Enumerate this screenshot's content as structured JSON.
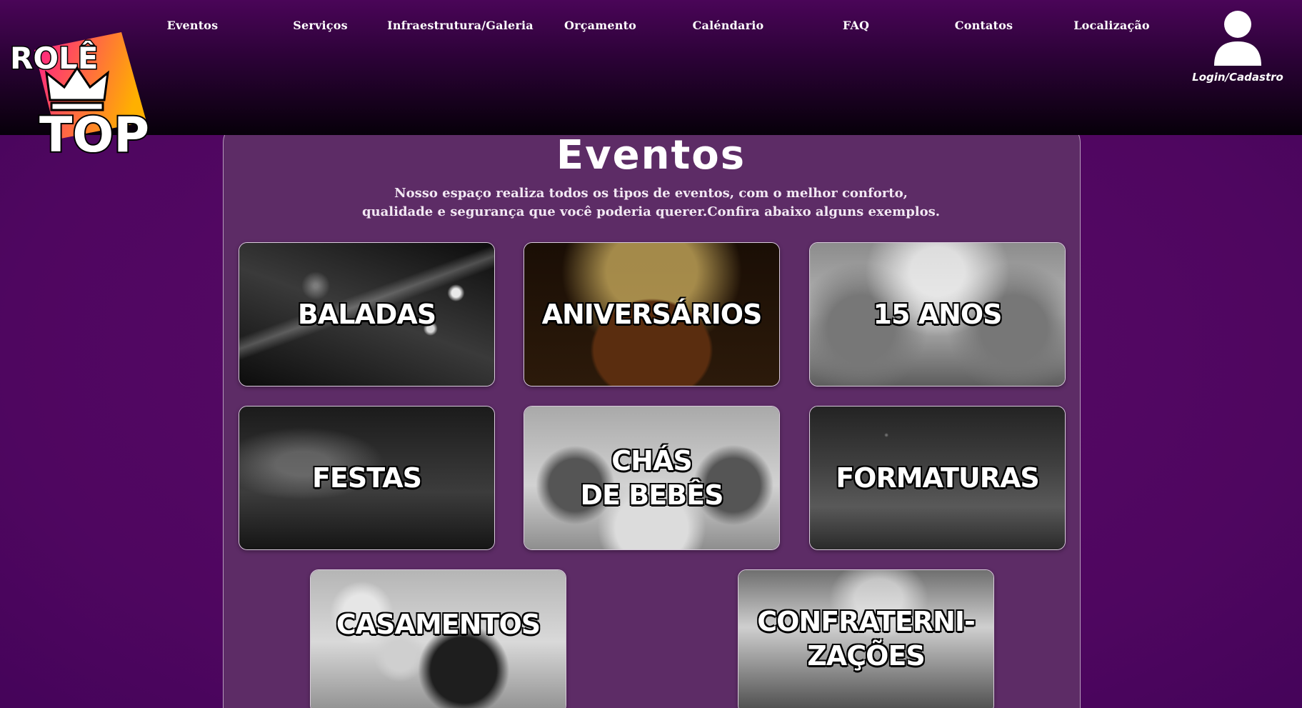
{
  "nav": {
    "items": [
      "Eventos",
      "Serviços",
      "Infraestrutura/Galeria",
      "Orçamento",
      "Caléndario",
      "FAQ",
      "Contatos",
      "Localização"
    ]
  },
  "login": {
    "label": "Login/Cadastro",
    "icon": "user-icon"
  },
  "logo": {
    "line1": "ROLÊ",
    "line2": "TOP",
    "icon": "crown-icon"
  },
  "section": {
    "title": "Eventos",
    "intro_line1": "Nosso espaço realiza todos os tipos de eventos, com o melhor conforto,",
    "intro_line2": "qualidade e segurança que você poderia querer.Confira abaixo alguns exemplos."
  },
  "cards": [
    {
      "label": "BALADAS"
    },
    {
      "label": "ANIVERSÁRIOS"
    },
    {
      "label": "15 ANOS"
    },
    {
      "label": "FESTAS"
    },
    {
      "label_line1": "CHÁS",
      "label_line2": "DE BEBÊS"
    },
    {
      "label": "FORMATURAS"
    },
    {
      "label": "CASAMENTOS"
    },
    {
      "label_line1": "CONFRATERNI-",
      "label_line2": "ZAÇÕES"
    }
  ],
  "colors": {
    "background": "#52075f",
    "panel": "#5d2c66",
    "logo_gradient_start": "#ff1a8c",
    "logo_gradient_end": "#ffb000"
  }
}
